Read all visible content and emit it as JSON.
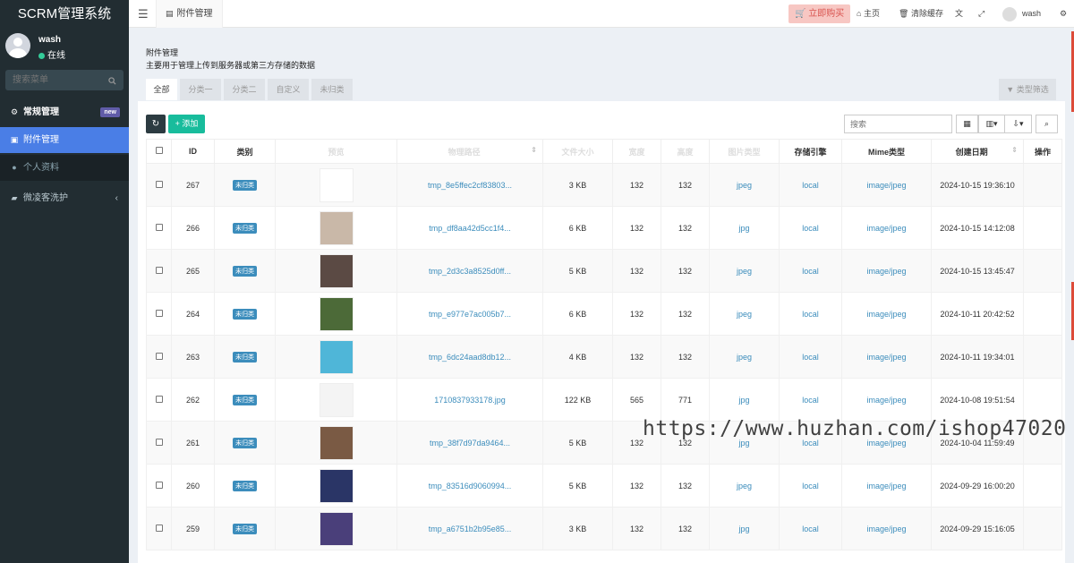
{
  "app": {
    "title": "SCRM管理系统"
  },
  "user": {
    "name": "wash",
    "status": "在线"
  },
  "sidebar": {
    "search_placeholder": "搜索菜单",
    "items": [
      {
        "label": "常规管理",
        "badge": "new"
      },
      {
        "label": "附件管理"
      },
      {
        "label": "个人资料"
      },
      {
        "label": "微凌客洗护"
      }
    ]
  },
  "topbar": {
    "tab": "附件管理",
    "buy": "立即购买",
    "home": "主页",
    "clear_cache": "清除缓存",
    "user": "wash"
  },
  "page": {
    "title": "附件管理",
    "desc": "主要用于管理上传到服务器或第三方存储的数据",
    "tabs": [
      "全部",
      "分类一",
      "分类二",
      "自定义",
      "未归类"
    ],
    "type_filter": "类型筛选"
  },
  "toolbar": {
    "add": "添加",
    "search_placeholder": "搜索"
  },
  "table": {
    "headers": [
      "ID",
      "类别",
      "预览",
      "物理路径",
      "文件大小",
      "宽度",
      "高度",
      "图片类型",
      "存储引擎",
      "Mime类型",
      "创建日期",
      "操作"
    ],
    "rows": [
      {
        "id": "267",
        "cat": "未归类",
        "path": "tmp_8e5ffec2cf83803...",
        "size": "3 KB",
        "w": "132",
        "h": "132",
        "type": "jpeg",
        "storage": "local",
        "mime": "image/jpeg",
        "date": "2024-10-15 19:36:10"
      },
      {
        "id": "266",
        "cat": "未归类",
        "path": "tmp_df8aa42d5cc1f4...",
        "size": "6 KB",
        "w": "132",
        "h": "132",
        "type": "jpg",
        "storage": "local",
        "mime": "image/jpeg",
        "date": "2024-10-15 14:12:08"
      },
      {
        "id": "265",
        "cat": "未归类",
        "path": "tmp_2d3c3a8525d0ff...",
        "size": "5 KB",
        "w": "132",
        "h": "132",
        "type": "jpeg",
        "storage": "local",
        "mime": "image/jpeg",
        "date": "2024-10-15 13:45:47"
      },
      {
        "id": "264",
        "cat": "未归类",
        "path": "tmp_e977e7ac005b7...",
        "size": "6 KB",
        "w": "132",
        "h": "132",
        "type": "jpeg",
        "storage": "local",
        "mime": "image/jpeg",
        "date": "2024-10-11 20:42:52"
      },
      {
        "id": "263",
        "cat": "未归类",
        "path": "tmp_6dc24aad8db12...",
        "size": "4 KB",
        "w": "132",
        "h": "132",
        "type": "jpeg",
        "storage": "local",
        "mime": "image/jpeg",
        "date": "2024-10-11 19:34:01"
      },
      {
        "id": "262",
        "cat": "未归类",
        "path": "1710837933178.jpg",
        "size": "122 KB",
        "w": "565",
        "h": "771",
        "type": "jpg",
        "storage": "local",
        "mime": "image/jpeg",
        "date": "2024-10-08 19:51:54"
      },
      {
        "id": "261",
        "cat": "未归类",
        "path": "tmp_38f7d97da9464...",
        "size": "5 KB",
        "w": "132",
        "h": "132",
        "type": "jpg",
        "storage": "local",
        "mime": "image/jpeg",
        "date": "2024-10-04 11:59:49"
      },
      {
        "id": "260",
        "cat": "未归类",
        "path": "tmp_83516d9060994...",
        "size": "5 KB",
        "w": "132",
        "h": "132",
        "type": "jpeg",
        "storage": "local",
        "mime": "image/jpeg",
        "date": "2024-09-29 16:00:20"
      },
      {
        "id": "259",
        "cat": "未归类",
        "path": "tmp_a6751b2b95e85...",
        "size": "3 KB",
        "w": "132",
        "h": "132",
        "type": "jpg",
        "storage": "local",
        "mime": "image/jpeg",
        "date": "2024-09-29 15:16:05"
      }
    ]
  },
  "watermark": "https://www.huzhan.com/ishop47020",
  "colors": {
    "sidebar": "#222d32",
    "active": "#4a7ee6",
    "add": "#18bc9c",
    "link": "#3c8dbc"
  }
}
